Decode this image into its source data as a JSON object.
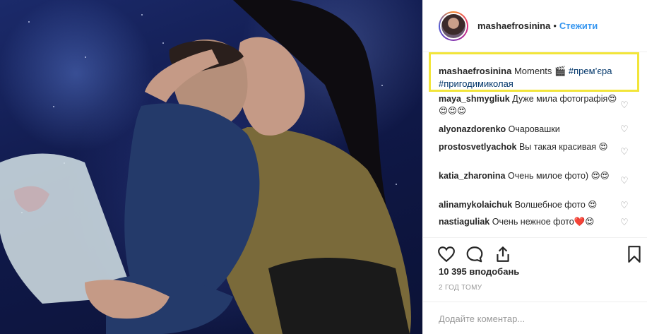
{
  "post": {
    "username": "mashaefrosinina",
    "separator": "•",
    "follow_label": "Стежити",
    "caption": {
      "username": "mashaefrosinina",
      "text": "Moments 🎬",
      "hashtag1": "#прем’єра",
      "hashtag2": "#пригодимиколая"
    },
    "comments": [
      {
        "user": "maya_shmygliuk",
        "text": "Дуже мила фотографія😍😍😍😍"
      },
      {
        "user": "alyonazdorenko",
        "text": "Очаровашки"
      },
      {
        "user": "prostosvetlyachok",
        "text": "Вы такая красивая 😍"
      },
      {
        "user": "katia_zharonina",
        "text": "Очень милое фото) 😍😍"
      },
      {
        "user": "alinamykolaichuk",
        "text": "Волшебное фото 😍"
      },
      {
        "user": "nastiaguliak",
        "text": "Очень нежное фото❤️😍"
      }
    ],
    "likes": "10 395 вподобань",
    "time": "2 ГОД ТОМУ",
    "add_comment_placeholder": "Додайте коментар..."
  },
  "icons": {
    "heart": "heart-icon",
    "comment": "comment-icon",
    "share": "share-icon",
    "bookmark": "bookmark-icon"
  },
  "colors": {
    "link_blue": "#3897f0",
    "hashtag": "#003569",
    "highlight": "#f2e53a",
    "muted": "#999999"
  }
}
